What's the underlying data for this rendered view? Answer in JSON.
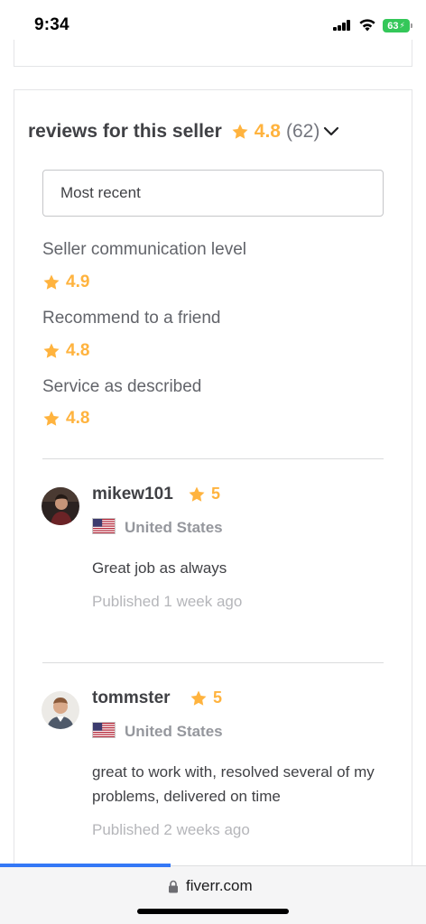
{
  "status_bar": {
    "time": "9:34",
    "battery": "63",
    "icons": [
      "signal-icon",
      "wifi-icon",
      "battery-icon"
    ]
  },
  "reviews": {
    "title": "reviews for this seller",
    "overall_rating": "4.8",
    "count": "(62)",
    "sort_value": "Most recent",
    "breakdown": [
      {
        "label": "Seller communication level",
        "score": "4.9"
      },
      {
        "label": "Recommend to a friend",
        "score": "4.8"
      },
      {
        "label": "Service as described",
        "score": "4.8"
      }
    ],
    "items": [
      {
        "username": "mikew101",
        "rating": "5",
        "country": "United States",
        "text": "Great job as always",
        "published": "Published 1 week ago"
      },
      {
        "username": "tommster",
        "rating": "5",
        "country": "United States",
        "text": "great to work with, resolved several of my problems, delivered on time",
        "published": "Published 2 weeks ago"
      }
    ]
  },
  "browser": {
    "url": "fiverr.com",
    "page_load_progress": 0.4
  },
  "colors": {
    "star": "#ffb33e",
    "battery": "#34c759",
    "progress": "#3478f6",
    "text_primary": "#404145",
    "text_muted": "#95979d"
  }
}
